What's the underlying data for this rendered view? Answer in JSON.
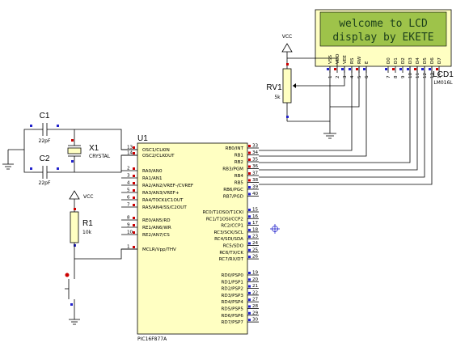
{
  "lcd": {
    "ref": "LCD1",
    "part": "LM016L",
    "line1": "welcome to LCD",
    "line2": "display by EKETE",
    "pin_names": [
      "VSS",
      "VDD",
      "VEE",
      "RS",
      "RW",
      "E",
      "D0",
      "D1",
      "D2",
      "D3",
      "D4",
      "D5",
      "D6",
      "D7"
    ],
    "pin_numbers": [
      "1",
      "2",
      "3",
      "4",
      "5",
      "6",
      "7",
      "8",
      "9",
      "10",
      "11",
      "12",
      "13",
      "14"
    ]
  },
  "mcu": {
    "ref": "U1",
    "part": "PIC16F877A",
    "left_pins": [
      {
        "name": "OSC1/CLKIN",
        "num": "13"
      },
      {
        "name": "OSC2/CLKOUT",
        "num": "14"
      },
      {
        "name": "RA0/AN0",
        "num": "2"
      },
      {
        "name": "RA1/AN1",
        "num": "3"
      },
      {
        "name": "RA2/AN2/VREF-/CVREF",
        "num": "4"
      },
      {
        "name": "RA3/AN3/VREF+",
        "num": "5"
      },
      {
        "name": "RA4/T0CKI/C1OUT",
        "num": "6"
      },
      {
        "name": "RA5/AN4/SS/C2OUT",
        "num": "7"
      },
      {
        "name": "RE0/AN5/RD",
        "num": "8"
      },
      {
        "name": "RE1/AN6/WR",
        "num": "9"
      },
      {
        "name": "RE2/AN7/CS",
        "num": "10"
      },
      {
        "name": "MCLR/Vpp/THV",
        "num": "1"
      }
    ],
    "right_pins": [
      {
        "name": "RB0/INT",
        "num": "33"
      },
      {
        "name": "RB1",
        "num": "34"
      },
      {
        "name": "RB2",
        "num": "35"
      },
      {
        "name": "RB3/PGM",
        "num": "36"
      },
      {
        "name": "RB4",
        "num": "37"
      },
      {
        "name": "RB5",
        "num": "38"
      },
      {
        "name": "RB6/PGC",
        "num": "39"
      },
      {
        "name": "RB7/PGD",
        "num": "40"
      },
      {
        "name": "RC0/T1OSO/T1CKI",
        "num": "15"
      },
      {
        "name": "RC1/T1OSI/CCP2",
        "num": "16"
      },
      {
        "name": "RC2/CCP1",
        "num": "17"
      },
      {
        "name": "RC3/SCK/SCL",
        "num": "18"
      },
      {
        "name": "RC4/SDI/SDA",
        "num": "23"
      },
      {
        "name": "RC5/SDO",
        "num": "24"
      },
      {
        "name": "RC6/TX/CK",
        "num": "25"
      },
      {
        "name": "RC7/RX/DT",
        "num": "26"
      },
      {
        "name": "RD0/PSP0",
        "num": "19"
      },
      {
        "name": "RD1/PSP1",
        "num": "20"
      },
      {
        "name": "RD2/PSP2",
        "num": "21"
      },
      {
        "name": "RD3/PSP3",
        "num": "22"
      },
      {
        "name": "RD4/PSP4",
        "num": "27"
      },
      {
        "name": "RD5/PSP5",
        "num": "28"
      },
      {
        "name": "RD6/PSP6",
        "num": "29"
      },
      {
        "name": "RD7/PSP7",
        "num": "30"
      }
    ]
  },
  "components": {
    "c1_ref": "C1",
    "c1_val": "22pF",
    "c2_ref": "C2",
    "c2_val": "22pF",
    "x1_ref": "X1",
    "x1_val": "CRYSTAL",
    "r1_ref": "R1",
    "r1_val": "10k",
    "rv1_ref": "RV1",
    "rv1_val": "5k",
    "vcc1": "VCC",
    "vcc2": "VCC"
  },
  "colors": {
    "component_fill": "#ffffc2",
    "lcd_screen": "#9ec34a",
    "lcd_bezel": "#ffffc2",
    "pin_red": "#cc0000",
    "pin_blue": "#2222cc"
  }
}
